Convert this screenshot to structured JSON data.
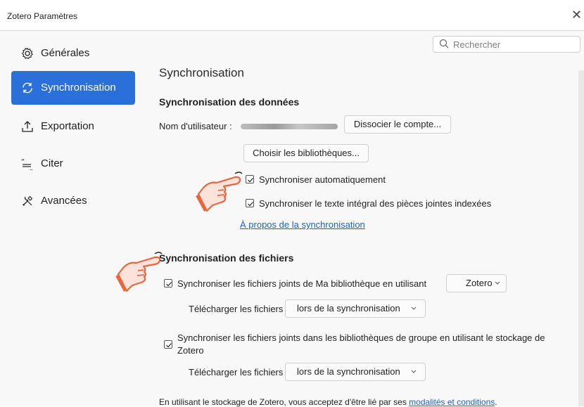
{
  "window": {
    "title": "Zotero Paramètres"
  },
  "search": {
    "placeholder": "Rechercher"
  },
  "sidebar": {
    "items": [
      {
        "label": "Générales",
        "icon": "gear-icon"
      },
      {
        "label": "Synchronisation",
        "icon": "sync-icon",
        "active": true
      },
      {
        "label": "Exportation",
        "icon": "export-icon"
      },
      {
        "label": "Citer",
        "icon": "quote-icon"
      },
      {
        "label": "Avancées",
        "icon": "tools-icon"
      }
    ]
  },
  "main": {
    "title": "Synchronisation",
    "data_sync": {
      "heading": "Synchronisation des données",
      "username_label": "Nom d'utilisateur :",
      "unlink_button": "Dissocier le compte...",
      "choose_libraries_button": "Choisir les bibliothèques...",
      "auto_sync": {
        "label": "Synchroniser automatiquement",
        "checked": true
      },
      "fulltext_sync": {
        "label": "Synchroniser le texte intégral des pièces jointes indexées",
        "checked": true
      },
      "about_link": "À propos de la synchronisation"
    },
    "file_sync": {
      "heading": "Synchronisation des fichiers",
      "my_library": {
        "label": "Synchroniser les fichiers joints de Ma bibliothèque en utilisant",
        "checked": true,
        "service": "Zotero"
      },
      "download_label": "Télécharger les fichiers",
      "download_value": "lors de la synchronisation",
      "group_libraries": {
        "label_line1": "Synchroniser les fichiers joints dans les bibliothèques de groupe en utilisant le stockage de",
        "label_line2": "Zotero",
        "checked": true
      },
      "download_label_2": "Télécharger les fichiers",
      "download_value_2": "lors de la synchronisation"
    },
    "footer": {
      "text": "En utilisant le stockage de Zotero, vous acceptez d'être lié par ses",
      "link": "modalités et conditions",
      "period": "."
    }
  },
  "colors": {
    "accent": "#2b6fdb",
    "link": "#1a62c9",
    "hand_fill": "#fbe3dc",
    "hand_outline": "#e9653b"
  }
}
